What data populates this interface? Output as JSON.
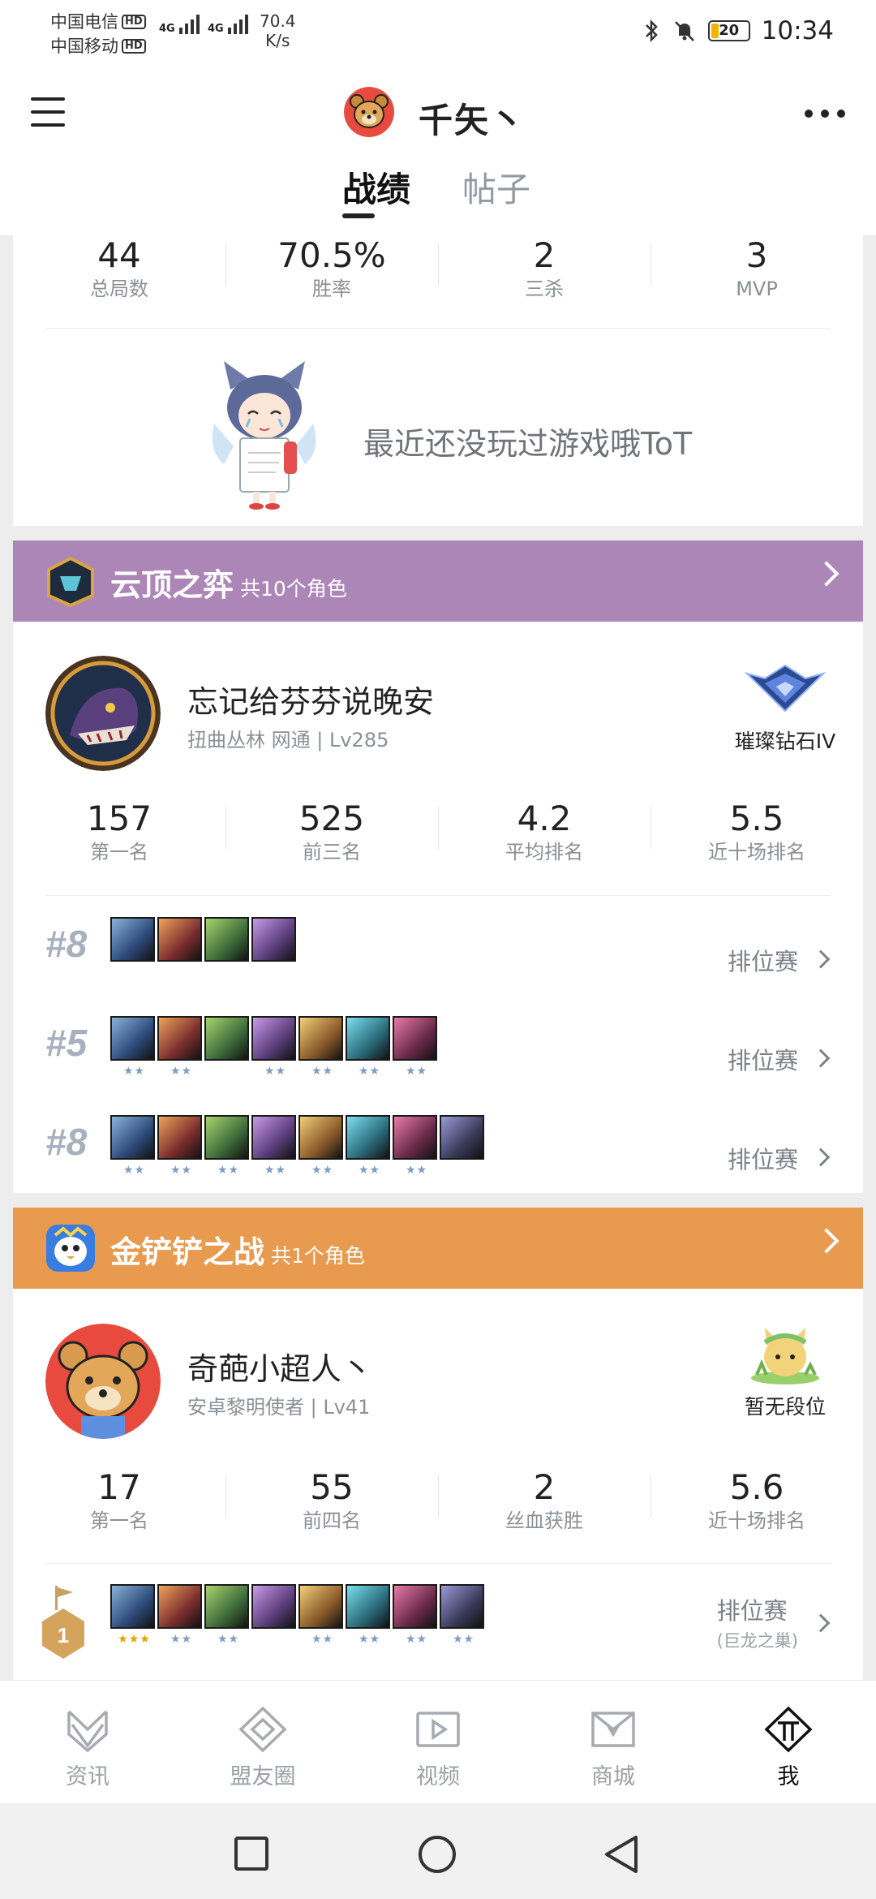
{
  "status_bar": {
    "carrier1": "中国电信",
    "carrier2": "中国移动",
    "hd": "HD",
    "net_type": "4G",
    "speed_value": "70.4",
    "speed_unit": "K/s",
    "battery": "20",
    "time": "10:34"
  },
  "header": {
    "name": "千矢丶",
    "tabs": [
      "战绩",
      "帖子"
    ]
  },
  "lol_summary": {
    "stats": [
      {
        "value": "44",
        "label": "总局数"
      },
      {
        "value": "70.5%",
        "label": "胜率"
      },
      {
        "value": "2",
        "label": "三杀"
      },
      {
        "value": "3",
        "label": "MVP"
      }
    ],
    "empty_text": "最近还没玩过游戏哦ToT"
  },
  "tft": {
    "title": "云顶之弈",
    "subtitle": "共10个角色",
    "color": "#ad86b8",
    "player_name": "忘记给芬芬说晚安",
    "player_sub": "扭曲丛林 网通 | Lv285",
    "rank": "璀璨钻石IV",
    "stats": [
      {
        "value": "157",
        "label": "第一名"
      },
      {
        "value": "525",
        "label": "前三名"
      },
      {
        "value": "4.2",
        "label": "平均排名"
      },
      {
        "value": "5.5",
        "label": "近十场排名"
      }
    ],
    "matches": [
      {
        "place": "#8",
        "mode": "排位赛",
        "units": 4,
        "stars": [
          0,
          0,
          0,
          0
        ]
      },
      {
        "place": "#5",
        "mode": "排位赛",
        "units": 7,
        "stars": [
          2,
          2,
          0,
          2,
          2,
          2,
          2
        ]
      },
      {
        "place": "#8",
        "mode": "排位赛",
        "units": 8,
        "stars": [
          2,
          2,
          2,
          2,
          2,
          2,
          2,
          0
        ]
      }
    ]
  },
  "chess": {
    "title": "金铲铲之战",
    "subtitle": "共1个角色",
    "color": "#e89a4e",
    "player_name": "奇葩小超人丶",
    "player_sub": "安卓黎明使者 | Lv41",
    "rank": "暂无段位",
    "stats": [
      {
        "value": "17",
        "label": "第一名"
      },
      {
        "value": "55",
        "label": "前四名"
      },
      {
        "value": "2",
        "label": "丝血获胜"
      },
      {
        "value": "5.6",
        "label": "近十场排名"
      }
    ],
    "match": {
      "place": "1",
      "mode": "排位赛",
      "mode_sub": "(巨龙之巢)",
      "units": 8,
      "stars": [
        3,
        2,
        2,
        0,
        2,
        2,
        2,
        2
      ]
    }
  },
  "bottom_nav": [
    {
      "label": "资讯",
      "icon": "news-icon"
    },
    {
      "label": "盟友圈",
      "icon": "friends-circle-icon"
    },
    {
      "label": "视频",
      "icon": "video-icon"
    },
    {
      "label": "商城",
      "icon": "store-icon"
    },
    {
      "label": "我",
      "icon": "me-icon"
    }
  ]
}
